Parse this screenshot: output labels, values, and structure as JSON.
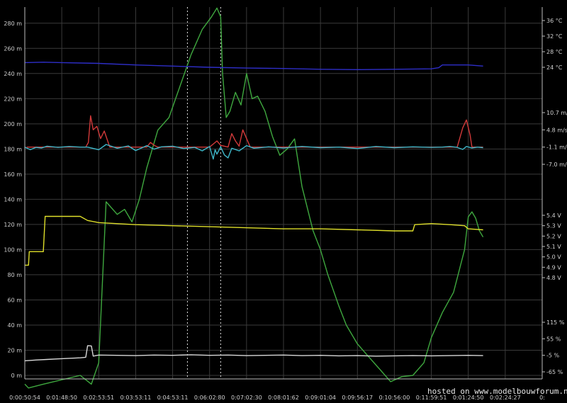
{
  "chart_data": {
    "type": "line",
    "grid": true,
    "background": "#000000",
    "grid_color": "#3a3a3a",
    "x_ticks": [
      "0:00:50:54",
      "0:01:48:50",
      "0:02:53:51",
      "0:03:53:11",
      "0:04:53:11",
      "0:06:02:80",
      "0:07:02:30",
      "0:08:01:62",
      "0:09:01:04",
      "0:09:56:17",
      "0:10:56:00",
      "0:11:59:51",
      "0:01:24:50",
      "0:02:24:27",
      "0:"
    ],
    "x_index_range": [
      0,
      14
    ],
    "altitude_axis": {
      "range": [
        0,
        290
      ],
      "ticks": [
        0,
        20,
        40,
        60,
        80,
        100,
        120,
        140,
        160,
        180,
        200,
        220,
        240,
        260,
        280
      ],
      "tick_labels": [
        "0 m",
        "20 m",
        "40 m",
        "60 m",
        "80 m",
        "100 m",
        "120 m",
        "140 m",
        "160 m",
        "180 m",
        "200 m",
        "220 m",
        "240 m",
        "260 m",
        "280 m"
      ]
    },
    "temperature_axis": {
      "range": [
        24,
        36
      ],
      "ticks": [
        24,
        28,
        32,
        36
      ],
      "tick_labels": [
        "24 °C",
        "28 °C",
        "32 °C",
        "36 °C"
      ]
    },
    "vario_axis": {
      "range": [
        -7.0,
        10.7
      ],
      "ticks": [
        10.7,
        4.8,
        -1.1,
        -7.0
      ],
      "tick_labels": [
        "10.7 m/s",
        "4.8 m/s",
        "-1.1 m/s",
        "-7.0 m/s"
      ]
    },
    "voltage_axis": {
      "range": [
        4.8,
        5.4
      ],
      "ticks": [
        5.4,
        5.3,
        5.2,
        5.1,
        5.0,
        4.9,
        4.8
      ],
      "tick_labels": [
        "5.4 V",
        "5.3 V",
        "5.2 V",
        "5.1 V",
        "5.0 V",
        "4.9 V",
        "4.8 V"
      ]
    },
    "percent_axis": {
      "range": [
        -65,
        115
      ],
      "ticks": [
        115,
        55,
        -5,
        -65
      ],
      "tick_labels": [
        "115 %",
        "55 %",
        "-5 %",
        "-65 %"
      ]
    },
    "markers_x": [
      4.4,
      5.3
    ],
    "series": [
      {
        "color": "#3fa83f",
        "axis": "altitude_axis",
        "x": [
          0,
          0.1,
          0.5,
          1.5,
          1.8,
          2.0,
          2.2,
          2.5,
          2.7,
          2.9,
          3.1,
          3.3,
          3.6,
          3.9,
          4.2,
          4.5,
          4.8,
          5.05,
          5.2,
          5.3,
          5.35,
          5.45,
          5.55,
          5.7,
          5.85,
          6.0,
          6.15,
          6.3,
          6.5,
          6.7,
          6.9,
          7.1,
          7.3,
          7.5,
          7.8,
          8.0,
          8.2,
          8.5,
          8.7,
          9.0,
          9.3,
          9.6,
          9.9,
          10.2,
          10.5,
          10.8,
          11.0,
          11.3,
          11.6,
          11.9,
          12.0,
          12.1,
          12.2,
          12.3,
          12.4
        ],
        "y": [
          -7,
          -10,
          -7,
          0,
          -7,
          10,
          138,
          128,
          132,
          122,
          140,
          165,
          195,
          205,
          230,
          255,
          275,
          285,
          292,
          285,
          240,
          205,
          210,
          225,
          215,
          240,
          220,
          222,
          210,
          190,
          175,
          180,
          188,
          150,
          115,
          100,
          80,
          55,
          40,
          25,
          15,
          5,
          -5,
          -1,
          0,
          10,
          30,
          50,
          66,
          100,
          126,
          130,
          125,
          115,
          110
        ]
      },
      {
        "color": "#2e2ec8",
        "axis": "temperature_axis",
        "x": [
          0,
          0.5,
          1,
          2,
          3,
          4,
          5,
          6,
          7,
          8,
          9,
          10,
          11,
          11.2,
          11.3,
          12,
          12.4
        ],
        "y": [
          25.2,
          25.3,
          25.2,
          25.0,
          24.6,
          24.3,
          24.0,
          23.8,
          23.7,
          23.5,
          23.4,
          23.5,
          23.6,
          23.9,
          24.6,
          24.6,
          24.3
        ]
      },
      {
        "color": "#d23a3a",
        "axis": "vario_axis",
        "x": [
          0.05,
          1.65,
          1.72,
          1.78,
          1.85,
          1.95,
          2.05,
          2.15,
          2.3,
          3.3,
          3.4,
          3.5,
          3.6,
          4.3,
          5.0,
          5.2,
          5.3,
          5.5,
          5.6,
          5.7,
          5.8,
          5.9,
          6.1,
          6.5,
          7.5,
          11.5,
          11.7,
          11.85,
          11.95,
          12.05,
          12.1,
          12.4
        ],
        "y": [
          -1.1,
          -1.1,
          0.5,
          9.6,
          4.8,
          6.0,
          1.8,
          4.4,
          -1.1,
          -1.1,
          0.5,
          -0.5,
          -1.1,
          -1.1,
          -1.1,
          1.0,
          -0.5,
          -1.1,
          3.5,
          1.0,
          -0.8,
          4.8,
          -1.1,
          -1.1,
          -1.1,
          -1.1,
          -1.1,
          5.5,
          8.2,
          3.0,
          -1.1,
          -1.1
        ]
      },
      {
        "color": "#3fb7c9",
        "axis": "vario_axis",
        "x": [
          0,
          0.15,
          0.3,
          0.45,
          0.6,
          0.9,
          1.2,
          1.5,
          1.7,
          2.0,
          2.2,
          2.5,
          2.8,
          3.0,
          3.3,
          3.5,
          3.7,
          4.0,
          4.3,
          4.6,
          4.8,
          5.0,
          5.1,
          5.15,
          5.2,
          5.3,
          5.4,
          5.5,
          5.6,
          5.8,
          6.0,
          6.2,
          6.6,
          7.0,
          7.5,
          8.0,
          8.5,
          9.0,
          9.5,
          10.0,
          10.5,
          11.0,
          11.3,
          11.5,
          11.7,
          11.85,
          11.95,
          12.1,
          12.25,
          12.4
        ],
        "y": [
          -1.1,
          -2.0,
          -1.2,
          -1.4,
          -0.8,
          -1.2,
          -0.9,
          -1.1,
          -1.1,
          -2.0,
          -0.2,
          -1.5,
          -0.7,
          -2.3,
          -0.6,
          -1.8,
          -1.0,
          -0.8,
          -1.6,
          -1.2,
          -2.4,
          -0.9,
          -5.2,
          -2.0,
          -3.5,
          -1.0,
          -3.8,
          -4.8,
          -1.5,
          -2.4,
          -0.6,
          -1.5,
          -1.0,
          -1.4,
          -0.9,
          -1.3,
          -1.1,
          -1.6,
          -0.9,
          -1.3,
          -1.0,
          -1.2,
          -1.1,
          -0.9,
          -1.2,
          -1.9,
          -0.9,
          -1.4,
          -1.1,
          -1.3
        ]
      },
      {
        "color": "#dede2a",
        "axis": "voltage_axis",
        "x": [
          0,
          0.1,
          0.12,
          0.5,
          0.55,
          1.5,
          1.7,
          2.0,
          3,
          4,
          5,
          6,
          7,
          8,
          9,
          10,
          10.5,
          10.55,
          11.0,
          11.5,
          11.9,
          12.0,
          12.4
        ],
        "y": [
          4.92,
          4.92,
          5.05,
          5.05,
          5.39,
          5.39,
          5.35,
          5.33,
          5.31,
          5.3,
          5.29,
          5.28,
          5.27,
          5.27,
          5.26,
          5.25,
          5.25,
          5.31,
          5.32,
          5.31,
          5.3,
          5.27,
          5.26
        ]
      },
      {
        "color": "#d8d8d8",
        "axis": "percent_axis",
        "x": [
          0,
          0.3,
          0.6,
          0.9,
          1.2,
          1.5,
          1.65,
          1.7,
          1.8,
          1.85,
          2.0,
          2.5,
          3,
          3.5,
          4,
          4.5,
          5,
          5.5,
          6,
          6.5,
          7,
          7.5,
          8,
          8.5,
          9,
          9.5,
          10,
          10.5,
          11,
          11.5,
          12,
          12.4
        ],
        "y": [
          -25,
          -22,
          -20,
          -18,
          -16,
          -14,
          -12,
          30,
          29,
          -8,
          -4,
          -5,
          -6,
          -4,
          -5,
          -3,
          -5,
          -4,
          -6,
          -5,
          -4,
          -6,
          -5,
          -7,
          -6,
          -8,
          -7,
          -6,
          -7,
          -6,
          -5,
          -6
        ]
      }
    ]
  },
  "watermark": "hosted on www.modelbouwforum.nl"
}
